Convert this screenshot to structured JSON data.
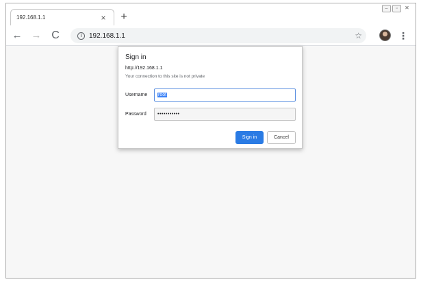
{
  "browser": {
    "tab": {
      "title": "192.168.1.1",
      "close_icon": "×"
    },
    "new_tab_icon": "+",
    "window_controls": {
      "minimize": "–",
      "maximize": "▫",
      "close": "✕"
    },
    "toolbar": {
      "back_icon": "←",
      "forward_icon": "→",
      "reload_icon": "C",
      "info_icon": "i",
      "url": "192.168.1.1",
      "star_icon": "☆",
      "menu_icon": "⋮"
    }
  },
  "dialog": {
    "title": "Sign in",
    "url": "http://192.168.1.1",
    "warning": "Your connection to this site is not private",
    "username_label": "Username",
    "username_value": "root",
    "password_label": "Password",
    "password_value": "•••••••••••",
    "signin_label": "Sign in",
    "cancel_label": "Cancel"
  },
  "colors": {
    "accent": "#2a7be4",
    "selection": "#3b82f7",
    "focus_border": "#5a8fe0"
  }
}
